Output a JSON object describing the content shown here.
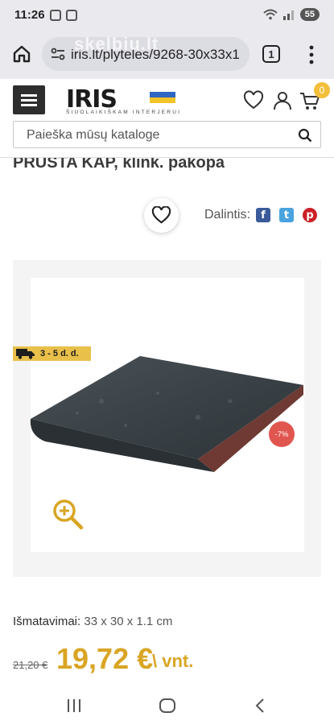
{
  "status_bar": {
    "time": "11:26",
    "battery": "55"
  },
  "browser": {
    "url": "iris.lt/plyteles/9268-30x33x1",
    "tab_count": "1",
    "watermark": "skelbiu.lt"
  },
  "header": {
    "logo_text": "IRIS",
    "logo_tagline": "ŠIUOLAIKIŠKAM INTERJERUI",
    "cart_count": "0",
    "search_placeholder": "Paieška mūsų kataloge"
  },
  "product": {
    "title": "PRUSTA KAP, klink. pakopa",
    "share_label": "Dalintis:",
    "delivery": "3 - 5 d. d.",
    "discount": "-7%",
    "dims_label": "Išmatavimai:",
    "dims_value": "33 x 30 x 1.1 cm",
    "old_price": "21,20 €",
    "price": "19,72 €",
    "unit": "\\ vnt."
  },
  "colors": {
    "accent": "#d9a524",
    "badge": "#e8c04a",
    "discount": "#e0564f",
    "dark": "#2e2e2e"
  }
}
